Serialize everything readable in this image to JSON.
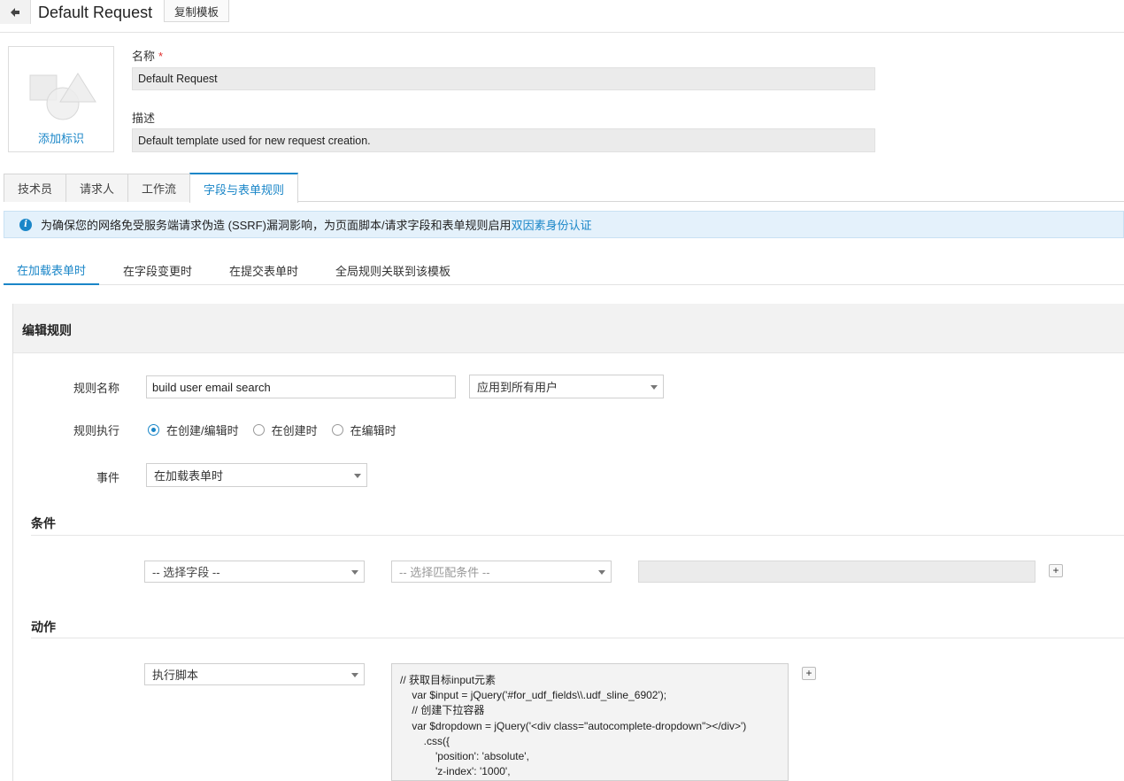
{
  "header": {
    "title": "Default Request",
    "copy_button": "复制模板"
  },
  "icon_box": {
    "add_label": "添加标识"
  },
  "fields": {
    "name_label": "名称",
    "required_mark": "*",
    "name_value": "Default Request",
    "desc_label": "描述",
    "desc_value": "Default template used for new request creation."
  },
  "main_tabs": [
    "技术员",
    "请求人",
    "工作流",
    "字段与表单规则"
  ],
  "banner": {
    "text": "为确保您的网络免受服务端请求伪造 (SSRF)漏洞影响，为页面脚本/请求字段和表单规则启用",
    "link": "双因素身份认证"
  },
  "sub_tabs": [
    "在加载表单时",
    "在字段变更时",
    "在提交表单时",
    "全局规则关联到该模板"
  ],
  "edit_rule": {
    "title": "编辑规则",
    "rule_name_label": "规则名称",
    "rule_name_value": "build user email search",
    "apply_to": "应用到所有用户",
    "execute_label": "规则执行",
    "execute_options": [
      "在创建/编辑时",
      "在创建时",
      "在编辑时"
    ],
    "event_label": "事件",
    "event_value": "在加载表单时"
  },
  "conditions": {
    "title": "条件",
    "field_placeholder": "-- 选择字段 --",
    "match_placeholder": "-- 选择匹配条件 --",
    "add": "+"
  },
  "actions": {
    "title": "动作",
    "action_value": "执行脚本",
    "add": "+",
    "script": "// 获取目标input元素\n    var $input = jQuery('#for_udf_fields\\\\.udf_sline_6902');\n    // 创建下拉容器\n    var $dropdown = jQuery('<div class=\"autocomplete-dropdown\"></div>')\n        .css({\n            'position': 'absolute',\n            'z-index': '1000',"
  }
}
